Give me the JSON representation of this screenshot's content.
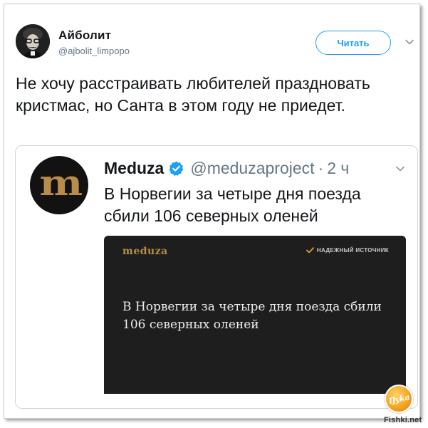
{
  "tweet": {
    "author_name": "Айболит",
    "author_handle": "@ajbolit_limpopo",
    "follow_label": "Читать",
    "text": "Не хочу расстраивать любителей праздновать кристмас, но Санта в этом году не приедет."
  },
  "quoted_tweet": {
    "avatar_glyph": "m",
    "author_name": "Meduza",
    "author_handle": "@meduzaproject",
    "separator": "·",
    "time": "2 ч",
    "text": "В Норвегии за четыре дня поезда сбили 106 северных оленей",
    "media": {
      "logo": "meduza",
      "source_label": "НАДЕЖНЫЙ ИСТОЧНИК",
      "headline": "В Норвегии за четыре дня поезда сбили 106 северных оленей"
    }
  },
  "watermark": {
    "badge": "Ŋyka",
    "site": "Fishki.net"
  },
  "colors": {
    "accent": "#1da1f2",
    "text": "#14171a",
    "secondary": "#657786",
    "border": "#ccd6dd",
    "media_bg": "#1e1e1e",
    "brand_gold": "#b88c4a"
  },
  "icons": {
    "caret": "chevron-down-icon",
    "verified": "verified-badge-icon",
    "check": "check-icon"
  }
}
